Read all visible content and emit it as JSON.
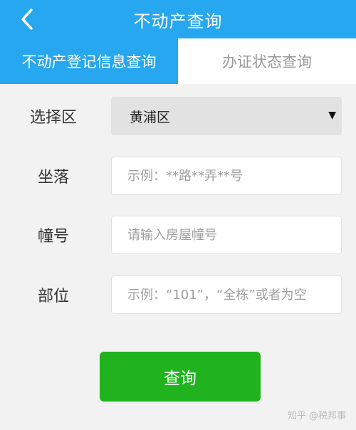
{
  "header": {
    "title": "不动产查询",
    "back_icon": "chevron-left-icon"
  },
  "tabs": [
    {
      "label": "不动产登记信息查询",
      "active": true
    },
    {
      "label": "办证状态查询",
      "active": false
    }
  ],
  "form": {
    "district": {
      "label": "选择区",
      "selected": "黄浦区"
    },
    "address": {
      "label": "坐落",
      "placeholder": "示例：**路**弄**号"
    },
    "building": {
      "label": "幢号",
      "placeholder": "请输入房屋幢号"
    },
    "unit": {
      "label": "部位",
      "placeholder": "示例：“101”，“全栋”或者为空"
    }
  },
  "submit_label": "查询",
  "watermark": "知乎 @税邦事",
  "colors": {
    "primary": "#27a7ef",
    "submit": "#20b31e",
    "background": "#f2f2f2"
  }
}
